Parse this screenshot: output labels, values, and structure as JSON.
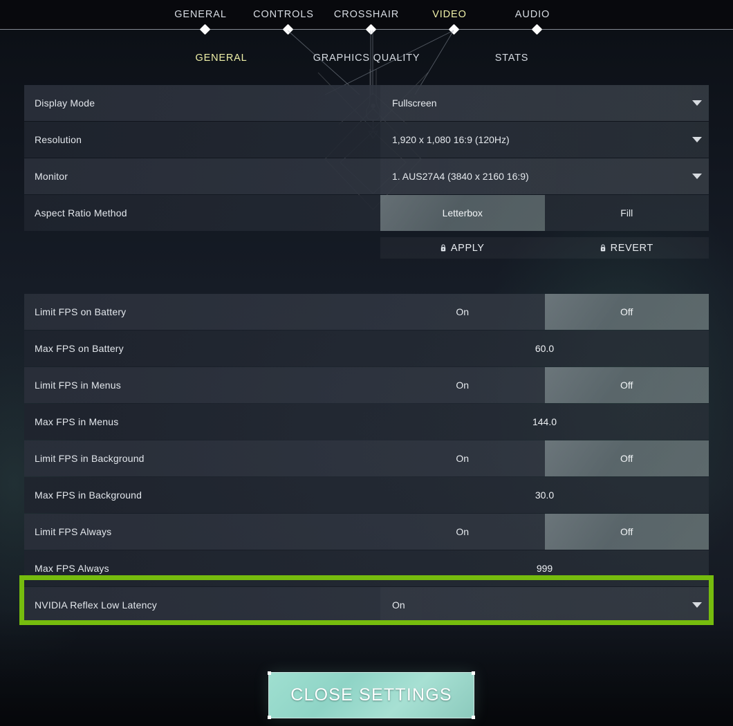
{
  "top_nav": {
    "tabs": [
      {
        "label": "GENERAL",
        "active": false
      },
      {
        "label": "CONTROLS",
        "active": false
      },
      {
        "label": "CROSSHAIR",
        "active": false
      },
      {
        "label": "VIDEO",
        "active": true
      },
      {
        "label": "AUDIO",
        "active": false
      }
    ],
    "active_color": "#eff0a8",
    "inactive_color": "#d6dbe2"
  },
  "sub_nav": {
    "tabs": [
      {
        "label": "GENERAL",
        "active": true
      },
      {
        "label": "GRAPHICS QUALITY",
        "active": false
      },
      {
        "label": "STATS",
        "active": false
      }
    ]
  },
  "display_group": {
    "rows": [
      {
        "label": "Display Mode",
        "value": "Fullscreen",
        "control": "dropdown"
      },
      {
        "label": "Resolution",
        "value": "1,920 x 1,080 16:9 (120Hz)",
        "control": "dropdown"
      },
      {
        "label": "Monitor",
        "value": "1. AUS27A4 (3840 x  2160 16:9)",
        "control": "dropdown"
      },
      {
        "label": "Aspect Ratio Method",
        "control": "segmented",
        "options": [
          "Letterbox",
          "Fill"
        ],
        "selected": "Letterbox"
      }
    ]
  },
  "action_bar": {
    "apply_label": "APPLY",
    "revert_label": "REVERT",
    "apply_icon": "lock-icon",
    "revert_icon": "lock-icon"
  },
  "fps_group": {
    "rows": [
      {
        "label": "Limit FPS on Battery",
        "control": "segmented",
        "options": [
          "On",
          "Off"
        ],
        "selected": "Off"
      },
      {
        "label": "Max FPS on Battery",
        "control": "number",
        "value": "60.0"
      },
      {
        "label": "Limit FPS in Menus",
        "control": "segmented",
        "options": [
          "On",
          "Off"
        ],
        "selected": "Off"
      },
      {
        "label": "Max FPS in Menus",
        "control": "number",
        "value": "144.0"
      },
      {
        "label": "Limit FPS in Background",
        "control": "segmented",
        "options": [
          "On",
          "Off"
        ],
        "selected": "Off"
      },
      {
        "label": "Max FPS in Background",
        "control": "number",
        "value": "30.0"
      },
      {
        "label": "Limit FPS Always",
        "control": "segmented",
        "options": [
          "On",
          "Off"
        ],
        "selected": "Off"
      },
      {
        "label": "Max FPS Always",
        "control": "number",
        "value": "999"
      },
      {
        "label": "NVIDIA Reflex Low Latency",
        "control": "dropdown",
        "value": "On",
        "highlighted": true
      }
    ]
  },
  "highlight": {
    "color": "#76bc0e",
    "target": "NVIDIA Reflex Low Latency"
  },
  "footer": {
    "close_label": "CLOSE SETTINGS",
    "close_color": "#9fdfd0"
  }
}
